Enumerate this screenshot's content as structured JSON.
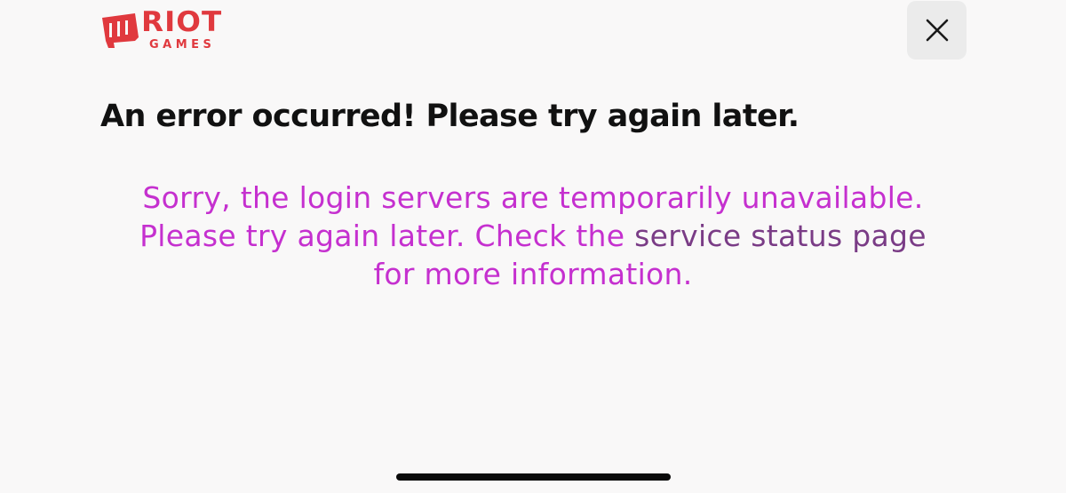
{
  "brand": {
    "word_top": "RIOT",
    "word_bottom": "GAMES",
    "color": "#e0393e",
    "icon": "riot-fist-icon"
  },
  "close_button": {
    "icon": "close-icon"
  },
  "error": {
    "heading": "An error occurred! Please try again later.",
    "message_line1": "Sorry, the login servers are temporarily unavailable.",
    "message_before_link": "Please try again later. Check the ",
    "link_text": "service status page",
    "message_after_link": "for more information.",
    "message_color": "#c530cf",
    "link_color": "#7a3c86"
  }
}
